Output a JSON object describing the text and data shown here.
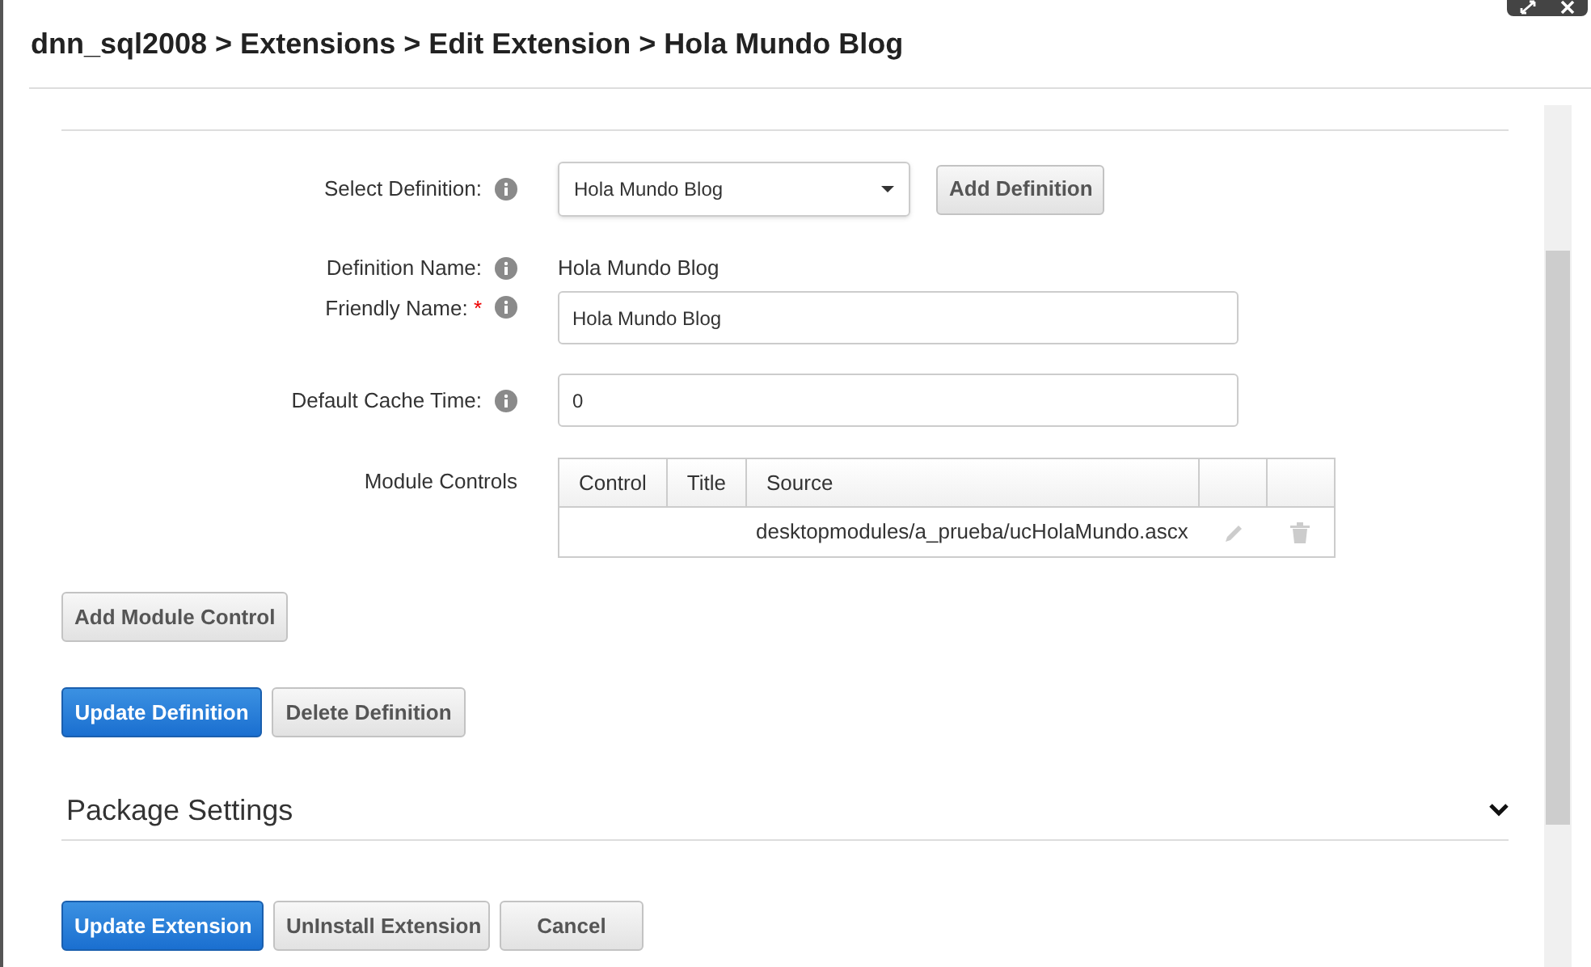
{
  "breadcrumb": "dnn_sql2008 > Extensions > Edit Extension > Hola Mundo Blog",
  "select_definition": {
    "label": "Select Definition:",
    "value": "Hola Mundo Blog",
    "button": "Add Definition"
  },
  "definition_name": {
    "label": "Definition Name:",
    "value": "Hola Mundo Blog"
  },
  "friendly_name": {
    "label": "Friendly Name:",
    "required_mark": "*",
    "value": "Hola Mundo Blog"
  },
  "default_cache_time": {
    "label": "Default Cache Time:",
    "value": "0"
  },
  "module_controls": {
    "label": "Module Controls",
    "columns": [
      "Control",
      "Title",
      "Source"
    ],
    "rows": [
      {
        "control": "",
        "title": "",
        "source": "desktopmodules/a_prueba/ucHolaMundo.ascx"
      }
    ]
  },
  "add_module_control": "Add Module Control",
  "definition_buttons": [
    {
      "label": "Update Definition",
      "primary": true
    },
    {
      "label": "Delete Definition",
      "primary": false
    }
  ],
  "package_settings": {
    "title": "Package Settings",
    "expanded": false
  },
  "footer_buttons": [
    {
      "label": "Update Extension",
      "primary": true
    },
    {
      "label": "UnInstall Extension",
      "primary": false
    },
    {
      "label": "Cancel",
      "primary": false
    }
  ]
}
